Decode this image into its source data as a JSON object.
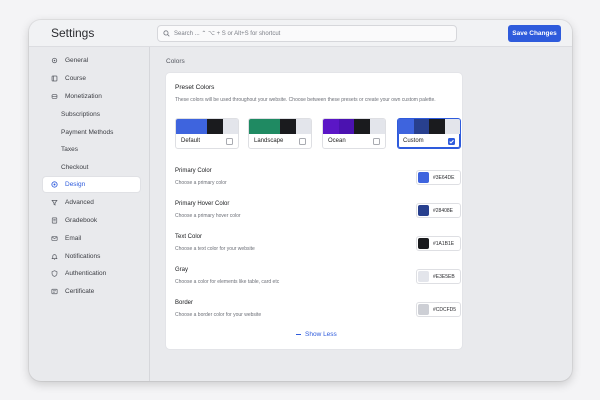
{
  "header": {
    "title": "Settings",
    "search_placeholder": "Search ... ⌃ ⌥ + S or Alt+S for shortcut",
    "save_label": "Save Changes"
  },
  "sidebar": {
    "items": [
      {
        "label": "General",
        "icon": "gear-icon"
      },
      {
        "label": "Course",
        "icon": "book-icon"
      },
      {
        "label": "Monetization",
        "icon": "coins-icon"
      },
      {
        "label": "Subscriptions"
      },
      {
        "label": "Payment Methods"
      },
      {
        "label": "Taxes"
      },
      {
        "label": "Checkout"
      },
      {
        "label": "Design",
        "icon": "palette-icon",
        "active": true
      },
      {
        "label": "Advanced",
        "icon": "filter-icon"
      },
      {
        "label": "Gradebook",
        "icon": "gradebook-icon"
      },
      {
        "label": "Email",
        "icon": "email-icon"
      },
      {
        "label": "Notifications",
        "icon": "bell-icon"
      },
      {
        "label": "Authentication",
        "icon": "shield-icon"
      },
      {
        "label": "Certificate",
        "icon": "certificate-icon"
      }
    ]
  },
  "main": {
    "section_label": "Colors",
    "preset_title": "Preset Colors",
    "preset_desc": "These colors will be used throughout your website. Choose between these presets or create your own custom palette.",
    "presets": [
      {
        "name": "Default",
        "colors": [
          "#3E64DE",
          "#3E64DE",
          "#1A1B1E",
          "#E3E5EB"
        ],
        "selected": false
      },
      {
        "name": "Landscape",
        "colors": [
          "#1F8A62",
          "#1F8A62",
          "#1A1B1E",
          "#E3E5EB"
        ],
        "selected": false
      },
      {
        "name": "Ocean",
        "colors": [
          "#5B16C6",
          "#4B12B0",
          "#1A1B1E",
          "#E3E5EB"
        ],
        "selected": false
      },
      {
        "name": "Custom",
        "colors": [
          "#3E64DE",
          "#28408E",
          "#1A1B1E",
          "#E3E5EB"
        ],
        "selected": true
      }
    ],
    "color_rows": [
      {
        "title": "Primary Color",
        "desc": "Choose a primary color",
        "hex": "#3E64DE"
      },
      {
        "title": "Primary Hover Color",
        "desc": "Choose a primary hover color",
        "hex": "#28408E"
      },
      {
        "title": "Text Color",
        "desc": "Choose a text color for your website",
        "hex": "#1A1B1E"
      },
      {
        "title": "Gray",
        "desc": "Choose a color for elements like table, card etc",
        "hex": "#E3E5EB"
      },
      {
        "title": "Border",
        "desc": "Choose a border color for your website",
        "hex": "#CDCFD5"
      }
    ],
    "show_less_label": "Show Less"
  },
  "colors": {
    "accent": "#2E5BDC"
  }
}
